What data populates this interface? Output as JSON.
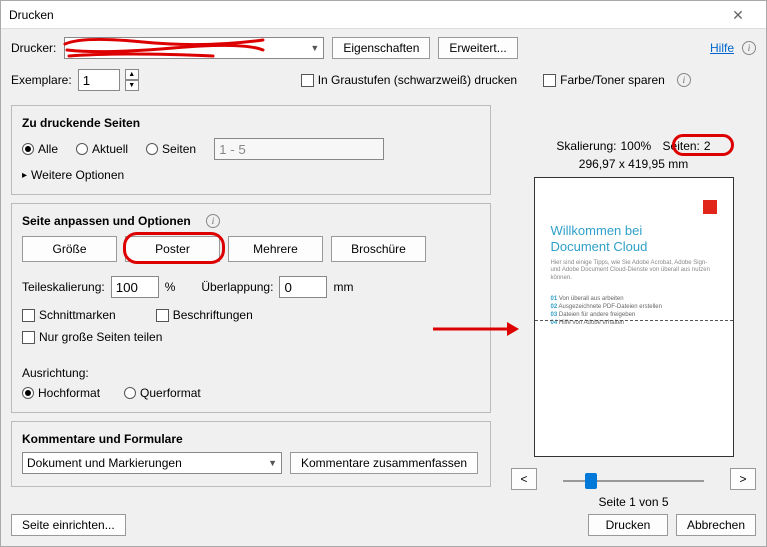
{
  "title": "Drucken",
  "help": "Hilfe",
  "top": {
    "printer_label": "Drucker:",
    "printer_value": "",
    "properties": "Eigenschaften",
    "advanced": "Erweitert...",
    "copies_label": "Exemplare:",
    "copies_value": "1",
    "grayscale": "In Graustufen (schwarzweiß) drucken",
    "save_toner": "Farbe/Toner sparen"
  },
  "pages": {
    "title": "Zu druckende Seiten",
    "all": "Alle",
    "current": "Aktuell",
    "range_label": "Seiten",
    "range_value": "1 - 5",
    "more": "Weitere Optionen"
  },
  "fit": {
    "title": "Seite anpassen und Optionen",
    "size": "Größe",
    "poster": "Poster",
    "multiple": "Mehrere",
    "booklet": "Broschüre",
    "tile_label": "Teileskalierung:",
    "tile_value": "100",
    "tile_unit": "%",
    "overlap_label": "Überlappung:",
    "overlap_value": "0",
    "overlap_unit": "mm",
    "cutmarks": "Schnittmarken",
    "labels": "Beschriftungen",
    "large_only": "Nur große Seiten teilen"
  },
  "orient": {
    "title": "Ausrichtung:",
    "portrait": "Hochformat",
    "landscape": "Querformat"
  },
  "comments": {
    "title": "Kommentare und Formulare",
    "value": "Dokument und Markierungen",
    "summarize": "Kommentare zusammenfassen"
  },
  "preview": {
    "scale_label": "Skalierung:",
    "scale_value": "100%",
    "pages_label": "Seiten:",
    "pages_value": "2",
    "dims": "296,97 x 419,95 mm",
    "doc_title1": "Willkommen bei",
    "doc_title2": "Document Cloud",
    "doc_sub": "Hier sind einige Tipps, wie Sie Adobe Acrobat, Adobe Sign- und Adobe Document Cloud-Dienste von überall aus nutzen können.",
    "li1_n": "01",
    "li1": "Von überall aus arbeiten",
    "li2_n": "02",
    "li2": "Ausgezeichnete PDF-Dateien erstellen",
    "li3_n": "03",
    "li3": "Dateien für andere freigeben",
    "li4_n": "04",
    "li4": "Hilfe von Adobe erhalten",
    "page_of": "Seite 1 von 5"
  },
  "footer": {
    "page_setup": "Seite einrichten...",
    "print": "Drucken",
    "cancel": "Abbrechen"
  }
}
